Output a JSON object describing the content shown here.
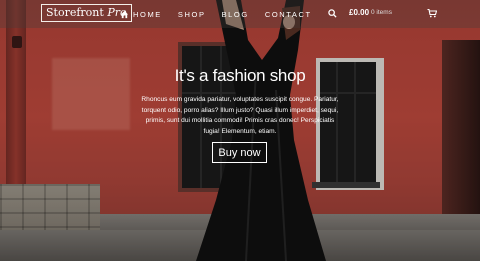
{
  "brand": {
    "name": "Storefront",
    "suffix": "Pro"
  },
  "nav": {
    "items": [
      {
        "label": "HOME",
        "icon": "home-icon"
      },
      {
        "label": "SHOP"
      },
      {
        "label": "BLOG"
      },
      {
        "label": "CONTACT"
      }
    ]
  },
  "cart": {
    "amount": "£0.00",
    "items": "0 items",
    "search_icon": "search-icon",
    "cart_icon": "cart-icon"
  },
  "hero": {
    "title": "It's a fashion shop",
    "description": "Rhoncus eum gravida pariatur, voluptates suscipit congue. Pariatur, torquent odio, porro alias? Illum justo? Quasi illum imperdiet, sequi, primis, sunt dui mollitia commodi! Primis cras donec! Perspiciatis fugia! Elementum, etiam.",
    "button": "Buy now"
  },
  "colors": {
    "wall": "#c24b3f",
    "overlay_text": "#ffffff"
  }
}
